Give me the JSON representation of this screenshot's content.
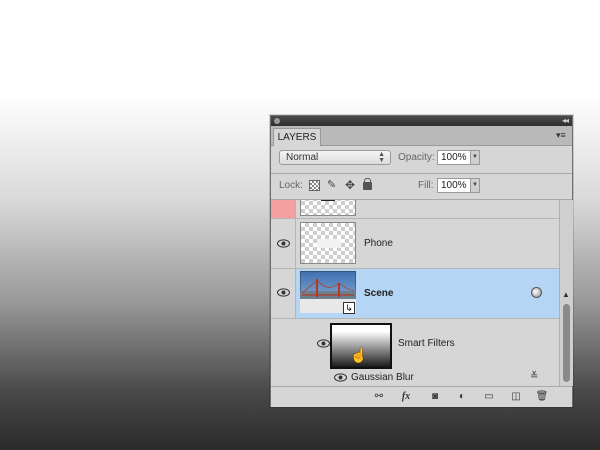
{
  "panel": {
    "tab_label": "LAYERS",
    "collapse_glyph": "◂◂",
    "menu_glyph": "▾≡"
  },
  "controls": {
    "blend_mode": "Normal",
    "opacity_label": "Opacity:",
    "opacity_value": "100%",
    "lock_label": "Lock:",
    "fill_label": "Fill:",
    "fill_value": "100%"
  },
  "layers": [
    {
      "name": "",
      "type": "partial-top",
      "visible": false,
      "color_tag": "#f4a0a0"
    },
    {
      "name": "Phone",
      "type": "layer",
      "visible": true
    },
    {
      "name": "Scene",
      "type": "smart-object",
      "visible": true,
      "selected": true
    },
    {
      "name": "Smart Filters",
      "type": "smart-filters",
      "visible": true
    },
    {
      "name": "Gaussian Blur",
      "type": "filter",
      "visible": true
    }
  ],
  "bottom_toolbar": [
    {
      "name": "link-layers-icon",
      "glyph": "⚯"
    },
    {
      "name": "fx-icon",
      "glyph": "fx"
    },
    {
      "name": "add-mask-icon",
      "glyph": "◙"
    },
    {
      "name": "adjustment-layer-icon",
      "glyph": "◐"
    },
    {
      "name": "new-group-icon",
      "glyph": "▭"
    },
    {
      "name": "new-layer-icon",
      "glyph": "◫"
    },
    {
      "name": "delete-layer-icon",
      "glyph": "🗑"
    }
  ],
  "colors": {
    "selection": "#b5d5f5",
    "panel_bg": "#d6d6d6"
  }
}
